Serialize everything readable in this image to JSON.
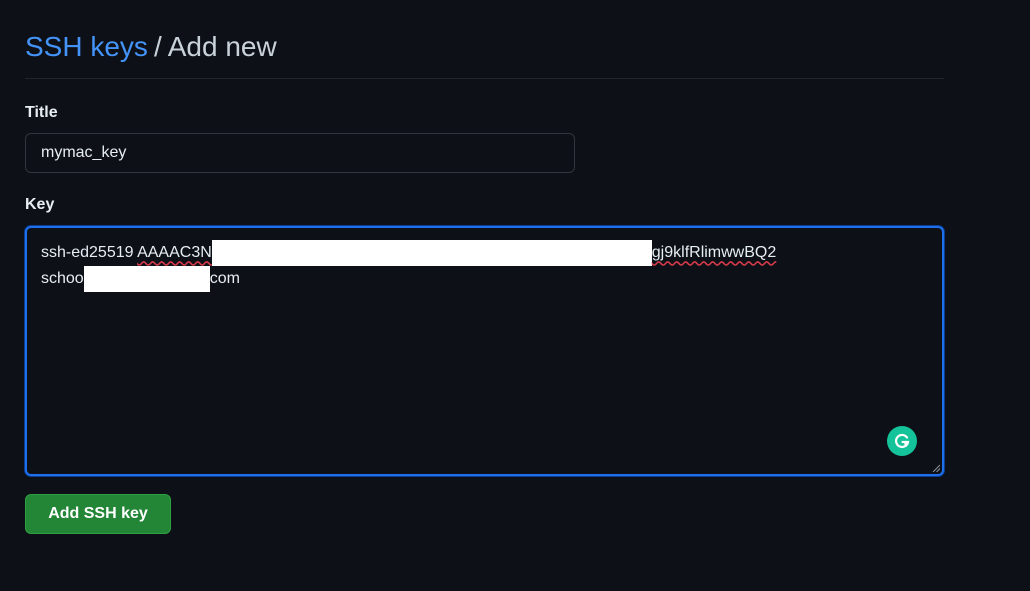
{
  "breadcrumb": {
    "parent": "SSH keys",
    "separator": "/",
    "current": "Add new"
  },
  "form": {
    "title_label": "Title",
    "title_value": "mymac_key",
    "key_label": "Key",
    "key_line1_prefix": "ssh-ed25519",
    "key_line1_start": "AAAAC3N",
    "key_line1_end": "gj9klfRlimwwBQ2",
    "key_line2_start": "schoo",
    "key_line2_end": "com",
    "submit_label": "Add SSH key"
  },
  "icons": {
    "grammarly": "grammarly-icon",
    "resize": "resize-handle-icon"
  },
  "colors": {
    "background": "#0d1117",
    "link": "#4493f8",
    "focus_border": "#1f6feb",
    "button": "#238636",
    "grammarly": "#15c39a"
  }
}
